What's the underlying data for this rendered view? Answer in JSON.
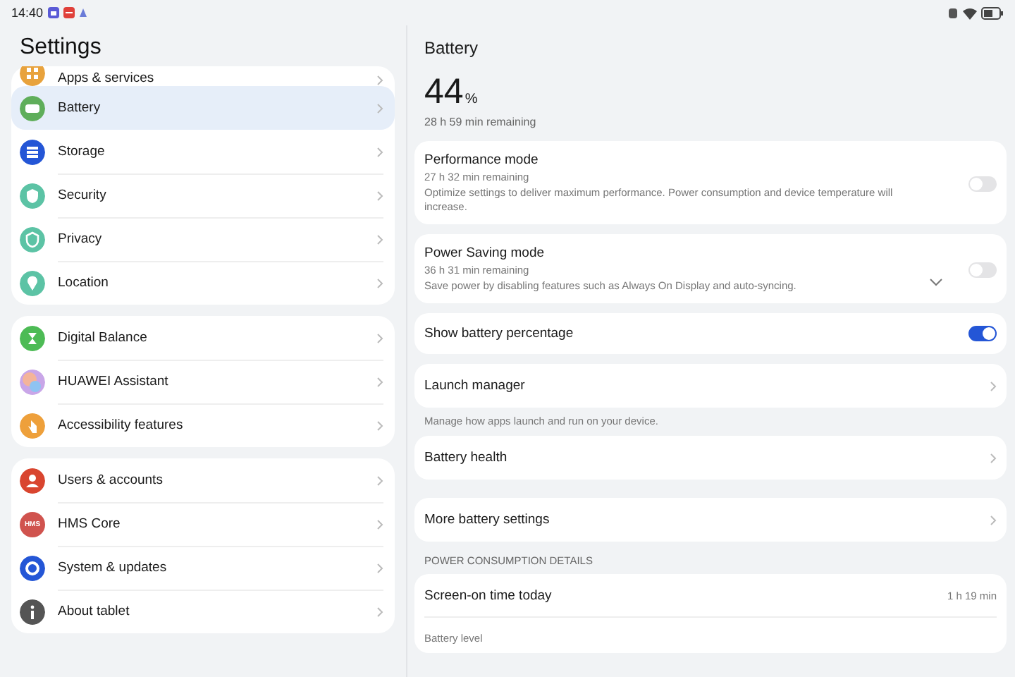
{
  "status_bar": {
    "time": "14:40"
  },
  "sidebar": {
    "title": "Settings",
    "groups": [
      {
        "items": [
          {
            "label": "Apps & services",
            "color": "#e8a23c",
            "selected": false
          },
          {
            "label": "Battery",
            "color": "#5fae5a",
            "selected": true
          },
          {
            "label": "Storage",
            "color": "#2456d6",
            "selected": false
          },
          {
            "label": "Security",
            "color": "#5cc3a5",
            "selected": false
          },
          {
            "label": "Privacy",
            "color": "#5cc3a5",
            "selected": false
          },
          {
            "label": "Location",
            "color": "#5cc3a5",
            "selected": false
          }
        ]
      },
      {
        "items": [
          {
            "label": "Digital Balance",
            "color": "#4dbb55",
            "selected": false
          },
          {
            "label": "HUAWEI Assistant",
            "color": "#c9a6e8",
            "selected": false
          },
          {
            "label": "Accessibility features",
            "color": "#eea03b",
            "selected": false
          }
        ]
      },
      {
        "items": [
          {
            "label": "Users & accounts",
            "color": "#d9452f",
            "selected": false
          },
          {
            "label": "HMS Core",
            "icon_text": "HMS",
            "color": "#d0534e",
            "selected": false
          },
          {
            "label": "System & updates",
            "color": "#2456d6",
            "selected": false
          },
          {
            "label": "About tablet",
            "color": "#555555",
            "selected": false
          }
        ]
      }
    ]
  },
  "detail": {
    "title": "Battery",
    "percent": "44",
    "percent_unit": "%",
    "remaining": "28 h 59 min remaining",
    "items": [
      {
        "kind": "toggle",
        "title": "Performance mode",
        "subtitle": "27 h 32 min remaining",
        "description": "Optimize settings to deliver maximum performance. Power consumption and device temperature will increase.",
        "on": false
      },
      {
        "kind": "toggle",
        "title": "Power Saving mode",
        "subtitle": "36 h 31 min remaining",
        "description": "Save power by disabling features such as Always On Display and auto-syncing.",
        "on": false,
        "expanded": false
      },
      {
        "kind": "toggle",
        "title": "Show battery percentage",
        "on": true
      },
      {
        "kind": "link",
        "title": "Launch manager"
      },
      {
        "kind": "caption",
        "text": "Manage how apps launch and run on your device."
      },
      {
        "kind": "link",
        "title": "Battery health"
      },
      {
        "kind": "link",
        "title": "More battery settings",
        "spaced": true
      },
      {
        "kind": "header",
        "text": "POWER CONSUMPTION DETAILS"
      },
      {
        "kind": "detail",
        "title": "Screen-on time today",
        "value": "1 h 19 min",
        "footer": "Battery level"
      }
    ]
  }
}
